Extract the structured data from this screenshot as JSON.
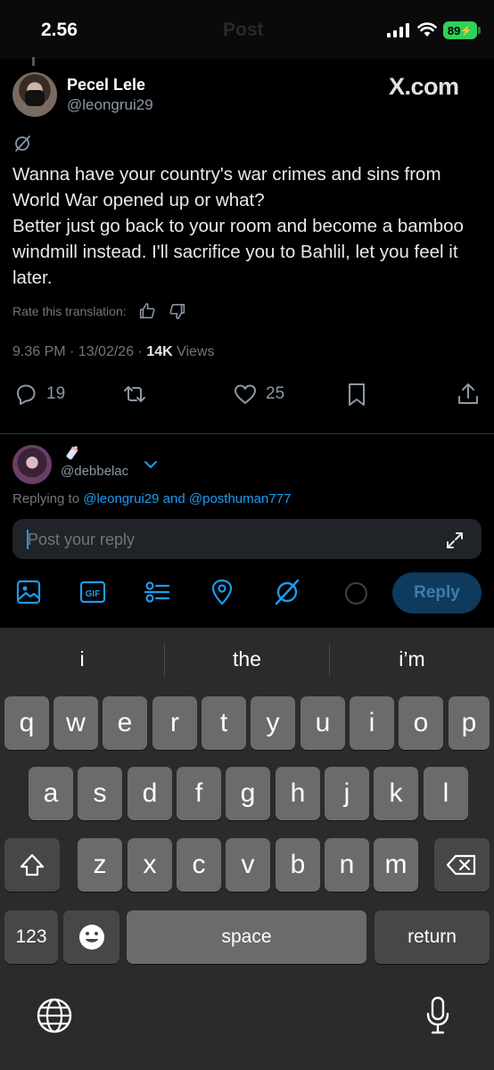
{
  "status_bar": {
    "time": "2.56",
    "battery": "89",
    "ghost_title": "Post"
  },
  "tweet": {
    "author_name": "Pecel Lele",
    "author_handle": "@leongrui29",
    "watermark": "X.com",
    "text": "Wanna have your country's war crimes and sins from World War opened up or what?\nBetter just go back to your room and become a bamboo windmill instead. I'll sacrifice you to Bahlil, let you feel it later.",
    "rate_label": "Rate this translation:",
    "time": "9.36 PM · 13/02/26 · ",
    "views_count": "14K",
    "views_label": " Views",
    "replies": "19",
    "likes": "25"
  },
  "reply": {
    "handle": "@debbelac",
    "replying_prefix": "Replying to ",
    "mention_1": "@leongrui29",
    "and": " and ",
    "mention_2": "@posthuman777",
    "placeholder": "Post your reply",
    "button_label": "Reply",
    "gif_label": "GIF"
  },
  "keyboard": {
    "suggestions": [
      "i",
      "the",
      "i’m"
    ],
    "row1": [
      "q",
      "w",
      "e",
      "r",
      "t",
      "y",
      "u",
      "i",
      "o",
      "p"
    ],
    "row2": [
      "a",
      "s",
      "d",
      "f",
      "g",
      "h",
      "j",
      "k",
      "l"
    ],
    "row3": [
      "z",
      "x",
      "c",
      "v",
      "b",
      "n",
      "m"
    ],
    "numbers_key": "123",
    "space_key": "space",
    "return_key": "return"
  },
  "colors": {
    "accent": "#1d9bf0",
    "battery": "#30d158",
    "muted": "#71767b"
  }
}
